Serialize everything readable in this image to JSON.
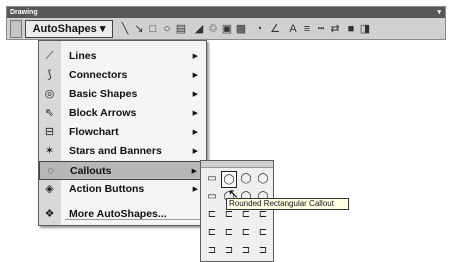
{
  "toolbar": {
    "title": "Drawing",
    "autoshapes_label": "AutoShapes",
    "autoshapes_arrow": "▾",
    "tools": [
      {
        "icon": "line-icon",
        "glyph": "╲"
      },
      {
        "icon": "arrow-icon",
        "glyph": "↘"
      },
      {
        "icon": "rectangle-icon",
        "glyph": "□"
      },
      {
        "icon": "oval-icon",
        "glyph": "○"
      },
      {
        "icon": "text-box-icon",
        "glyph": "▤"
      },
      {
        "icon": "wordart-icon",
        "glyph": "◢"
      },
      {
        "icon": "diagram-icon",
        "glyph": "♲"
      },
      {
        "icon": "clip-art-icon",
        "glyph": "▣"
      },
      {
        "icon": "picture-icon",
        "glyph": "▩"
      },
      {
        "icon": "fill-color-icon",
        "glyph": "◔"
      },
      {
        "icon": "line-color-icon",
        "glyph": "∠"
      },
      {
        "icon": "font-color-icon",
        "glyph": "A"
      },
      {
        "icon": "line-style-icon",
        "glyph": "≡"
      },
      {
        "icon": "dash-style-icon",
        "glyph": "┅"
      },
      {
        "icon": "arrow-style-icon",
        "glyph": "⇄"
      },
      {
        "icon": "shadow-icon",
        "glyph": "■"
      },
      {
        "icon": "3d-icon",
        "glyph": "◨"
      }
    ]
  },
  "menu": {
    "items": [
      {
        "icon": "lines-icon",
        "glyph": "⟋",
        "label": "Lines",
        "arrow": "▶"
      },
      {
        "icon": "connectors-icon",
        "glyph": "⟆",
        "label": "Connectors",
        "arrow": "▶"
      },
      {
        "icon": "basic-shapes-icon",
        "glyph": "◎",
        "label": "Basic Shapes",
        "arrow": "▶"
      },
      {
        "icon": "block-arrows-icon",
        "glyph": "⇖",
        "label": "Block Arrows",
        "arrow": "▶"
      },
      {
        "icon": "flowchart-icon",
        "glyph": "⊟",
        "label": "Flowchart",
        "arrow": "▶"
      },
      {
        "icon": "stars-banners-icon",
        "glyph": "✶",
        "label": "Stars and Banners",
        "arrow": "▶"
      },
      {
        "icon": "callouts-icon",
        "glyph": "◌",
        "label": "Callouts",
        "arrow": "▶"
      },
      {
        "icon": "action-buttons-icon",
        "glyph": "◈",
        "label": "Action Buttons",
        "arrow": "▶"
      },
      {
        "icon": "more-autoshapes-icon",
        "glyph": "❖",
        "label": "More AutoShapes...",
        "arrow": ""
      }
    ]
  },
  "submenu": {
    "callouts": [
      "▭",
      "◯",
      "◯",
      "◯",
      "▭",
      "◯",
      "◯",
      "◯",
      "⊏",
      "⊏",
      "⊏",
      "⊏",
      "⊏",
      "⊏",
      "⊏",
      "⊏",
      "⊐",
      "⊐",
      "⊐",
      "⊐"
    ]
  },
  "tooltip": "Rounded Rectangular Callout",
  "cursor": "↖"
}
